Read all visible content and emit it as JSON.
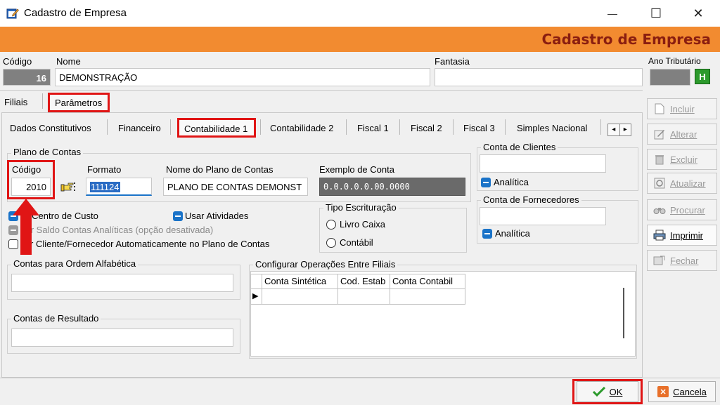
{
  "window": {
    "title": "Cadastro de Empresa",
    "minimize_glyph": "—",
    "maximize_glyph": "☐",
    "close_glyph": "✕"
  },
  "banner": {
    "title": "Cadastro de Empresa",
    "color": "#f28b30",
    "text_color": "#8a1e10"
  },
  "header": {
    "codigo_label": "Código",
    "codigo_value": "16",
    "nome_label": "Nome",
    "nome_value": "DEMONSTRAÇÃO",
    "fantasia_label": "Fantasia",
    "fantasia_value": "",
    "ano_label": "Ano Tributário",
    "ano_button": "H"
  },
  "top_tabs": [
    "Filiais",
    "Parâmetros"
  ],
  "sub_tabs": [
    "Dados Constitutivos",
    "Financeiro",
    "Contabilidade 1",
    "Contabilidade 2",
    "Fiscal 1",
    "Fiscal 2",
    "Fiscal 3",
    "Simples Nacional"
  ],
  "tab_scroll": {
    "left": "◂",
    "right": "▸"
  },
  "plano": {
    "group_title": "Plano de Contas",
    "codigo_label": "Código",
    "codigo_value": "2010",
    "formato_label": "Formato",
    "formato_value": "111124",
    "nome_label": "Nome do Plano de Contas",
    "nome_value": "PLANO DE CONTAS DEMONST",
    "exemplo_label": "Exemplo de Conta",
    "exemplo_value": "0.0.0.0.0.00.0000"
  },
  "options": {
    "centro_custo": "ar Centro de Custo",
    "atividades": "Usar Atividades",
    "saldo": "var Saldo  Contas Analíticas (opção desativada)",
    "incluir": "luir Cliente/Fornecedor Automaticamente no Plano de Contas"
  },
  "tipo_escrituracao": {
    "title": "Tipo Escrituração",
    "livro_caixa": "Livro Caixa",
    "contabil": "Contábil"
  },
  "clientes": {
    "title": "Conta de Clientes",
    "analitica": "Analítica"
  },
  "fornecedores": {
    "title": "Conta de Fornecedores",
    "analitica": "Analítica"
  },
  "ordem": {
    "title": "Contas para Ordem  Alfabética"
  },
  "resultado": {
    "title": "Contas de Resultado"
  },
  "operacoes": {
    "title": "Configurar Operações Entre Filiais",
    "columns": [
      "Conta Sintética",
      "Cod. Estab",
      "Conta Contabil"
    ],
    "row_marker": "▶"
  },
  "side_buttons": {
    "incluir": "Incluir",
    "alterar": "Alterar",
    "excluir": "Excluir",
    "atualizar": "Atualizar",
    "procurar": "Procurar",
    "imprimir": "Imprimir",
    "fechar": "Fechar"
  },
  "bottom": {
    "ok": "OK",
    "cancela": "Cancela"
  },
  "highlight_color": "#e01515"
}
